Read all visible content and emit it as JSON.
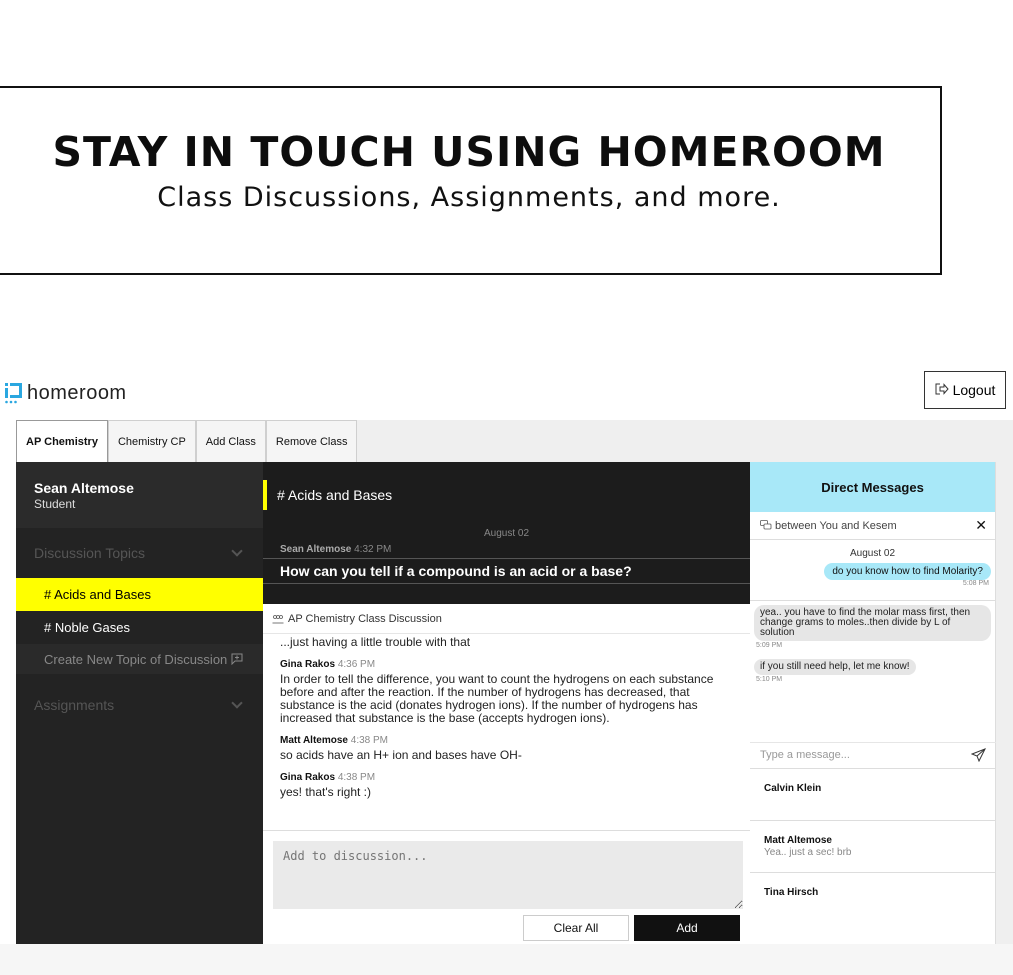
{
  "promo": {
    "title": "STAY IN TOUCH USING HOMEROOM",
    "subtitle": "Class Discussions, Assignments, and more."
  },
  "header": {
    "logo_text": "homeroom",
    "logout_label": "Logout"
  },
  "tabs": [
    {
      "label": "AP Chemistry",
      "active": true
    },
    {
      "label": "Chemistry CP"
    },
    {
      "label": "Add Class"
    },
    {
      "label": "Remove Class"
    }
  ],
  "sidebar": {
    "user_name": "Sean Altemose",
    "user_role": "Student",
    "discussion_heading": "Discussion Topics",
    "topics": [
      "# Acids and Bases",
      "# Noble Gases"
    ],
    "create_topic_label": "Create New Topic of Discussion",
    "assignments_heading": "Assignments"
  },
  "channel": {
    "title": "# Acids and Bases",
    "pinned_date": "August 02",
    "pinned_author": "Sean Altemose",
    "pinned_time": "4:32 PM",
    "pinned_question": "How can you tell if a compound is an acid or a base?",
    "discussion_label": "AP Chemistry Class Discussion"
  },
  "messages": [
    {
      "author": "",
      "time": "",
      "text": "...just having a little trouble with that"
    },
    {
      "author": "Gina Rakos",
      "time": "4:36 PM",
      "text": "In order to tell the difference, you want to count the hydrogens on each substance before and after the reaction. If the number of hydrogens has decreased, that substance is the acid (donates hydrogen ions). If the number of hydrogens has increased that substance is the base (accepts hydrogen ions)."
    },
    {
      "author": "Matt Altemose",
      "time": "4:38 PM",
      "text": "so acids have an H+ ion and bases have OH-"
    },
    {
      "author": "Gina Rakos",
      "time": "4:38 PM",
      "text": "yes! that's right :)"
    }
  ],
  "composer": {
    "placeholder": "Add to discussion...",
    "clear_label": "Clear All",
    "add_label": "Add"
  },
  "dm": {
    "title": "Direct Messages",
    "thread_label": "between You and Kesem",
    "date": "August 02",
    "msg1": "do you know how to find Molarity?",
    "msg1_time": "5:08 PM",
    "msg2": "yea.. you have to find the molar mass first, then change grams to moles..then divide by L of solution",
    "msg2_time": "5:09 PM",
    "msg3": "if you still need help, let me know!",
    "msg3_time": "5:10 PM",
    "input_placeholder": "Type a message...",
    "contacts": [
      {
        "name": "Calvin Klein",
        "preview": ""
      },
      {
        "name": "Matt Altemose",
        "preview": "Yea.. just a sec! brb"
      },
      {
        "name": "Tina Hirsch",
        "preview": ""
      }
    ]
  },
  "colors": {
    "accent_yellow": "#ffff00",
    "dm_blue": "#a8e8f8",
    "sidebar_dark": "#232323"
  }
}
